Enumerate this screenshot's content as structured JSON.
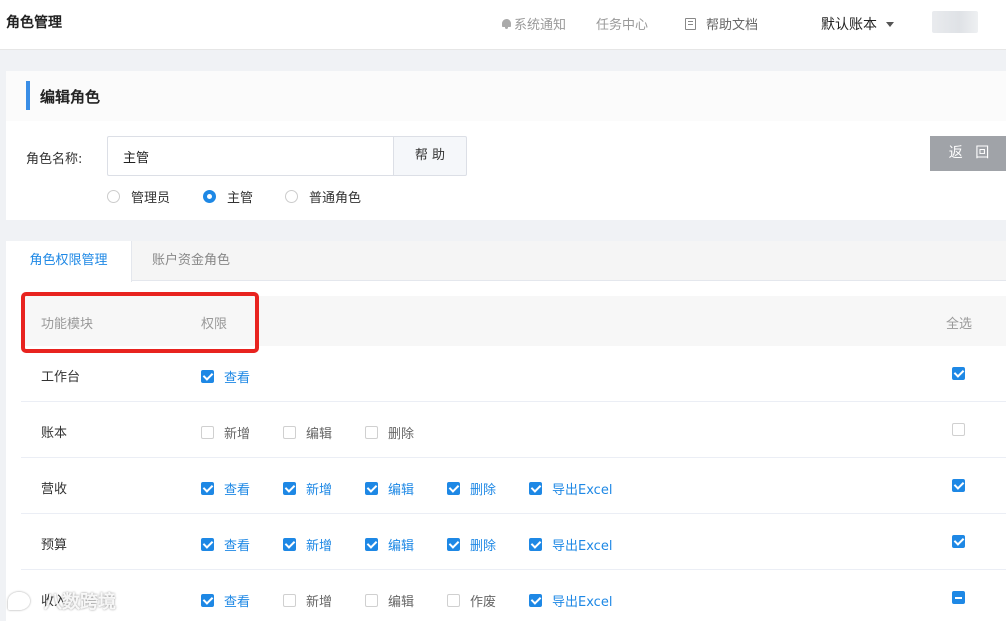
{
  "topbar": {
    "title": "角色管理",
    "notice": "系统通知",
    "tasks": "任务中心",
    "help_docs": "帮助文档",
    "account": "默认账本"
  },
  "edit": {
    "heading": "编辑角色",
    "name_label": "角色名称:",
    "name_value": "主管",
    "help_button": "帮 助",
    "back_button": "返 回",
    "roles": [
      {
        "label": "管理员",
        "selected": false
      },
      {
        "label": "主管",
        "selected": true
      },
      {
        "label": "普通角色",
        "selected": false
      }
    ]
  },
  "tabs": [
    "角色权限管理",
    "账户资金角色"
  ],
  "table": {
    "headers": {
      "module": "功能模块",
      "perm": "权限",
      "select_all": "全选"
    },
    "rows": [
      {
        "module": "工作台",
        "perms": [
          {
            "label": "查看",
            "checked": true
          }
        ],
        "all": "checked"
      },
      {
        "module": "账本",
        "perms": [
          {
            "label": "新增",
            "checked": false
          },
          {
            "label": "编辑",
            "checked": false
          },
          {
            "label": "删除",
            "checked": false
          }
        ],
        "all": "unchecked"
      },
      {
        "module": "营收",
        "perms": [
          {
            "label": "查看",
            "checked": true
          },
          {
            "label": "新增",
            "checked": true
          },
          {
            "label": "编辑",
            "checked": true
          },
          {
            "label": "删除",
            "checked": true
          },
          {
            "label": "导出Excel",
            "checked": true
          }
        ],
        "all": "checked"
      },
      {
        "module": "预算",
        "perms": [
          {
            "label": "查看",
            "checked": true
          },
          {
            "label": "新增",
            "checked": true
          },
          {
            "label": "编辑",
            "checked": true
          },
          {
            "label": "删除",
            "checked": true
          },
          {
            "label": "导出Excel",
            "checked": true
          }
        ],
        "all": "checked"
      },
      {
        "module": "收入",
        "perms": [
          {
            "label": "查看",
            "checked": true
          },
          {
            "label": "新增",
            "checked": false
          },
          {
            "label": "编辑",
            "checked": false
          },
          {
            "label": "作废",
            "checked": false
          },
          {
            "label": "导出Excel",
            "checked": true
          }
        ],
        "all": "partial"
      }
    ]
  },
  "watermark": "八数跨境",
  "colors": {
    "accent": "#1e88e5",
    "highlight": "#e8231f",
    "back_button": "#a0a3a8"
  }
}
